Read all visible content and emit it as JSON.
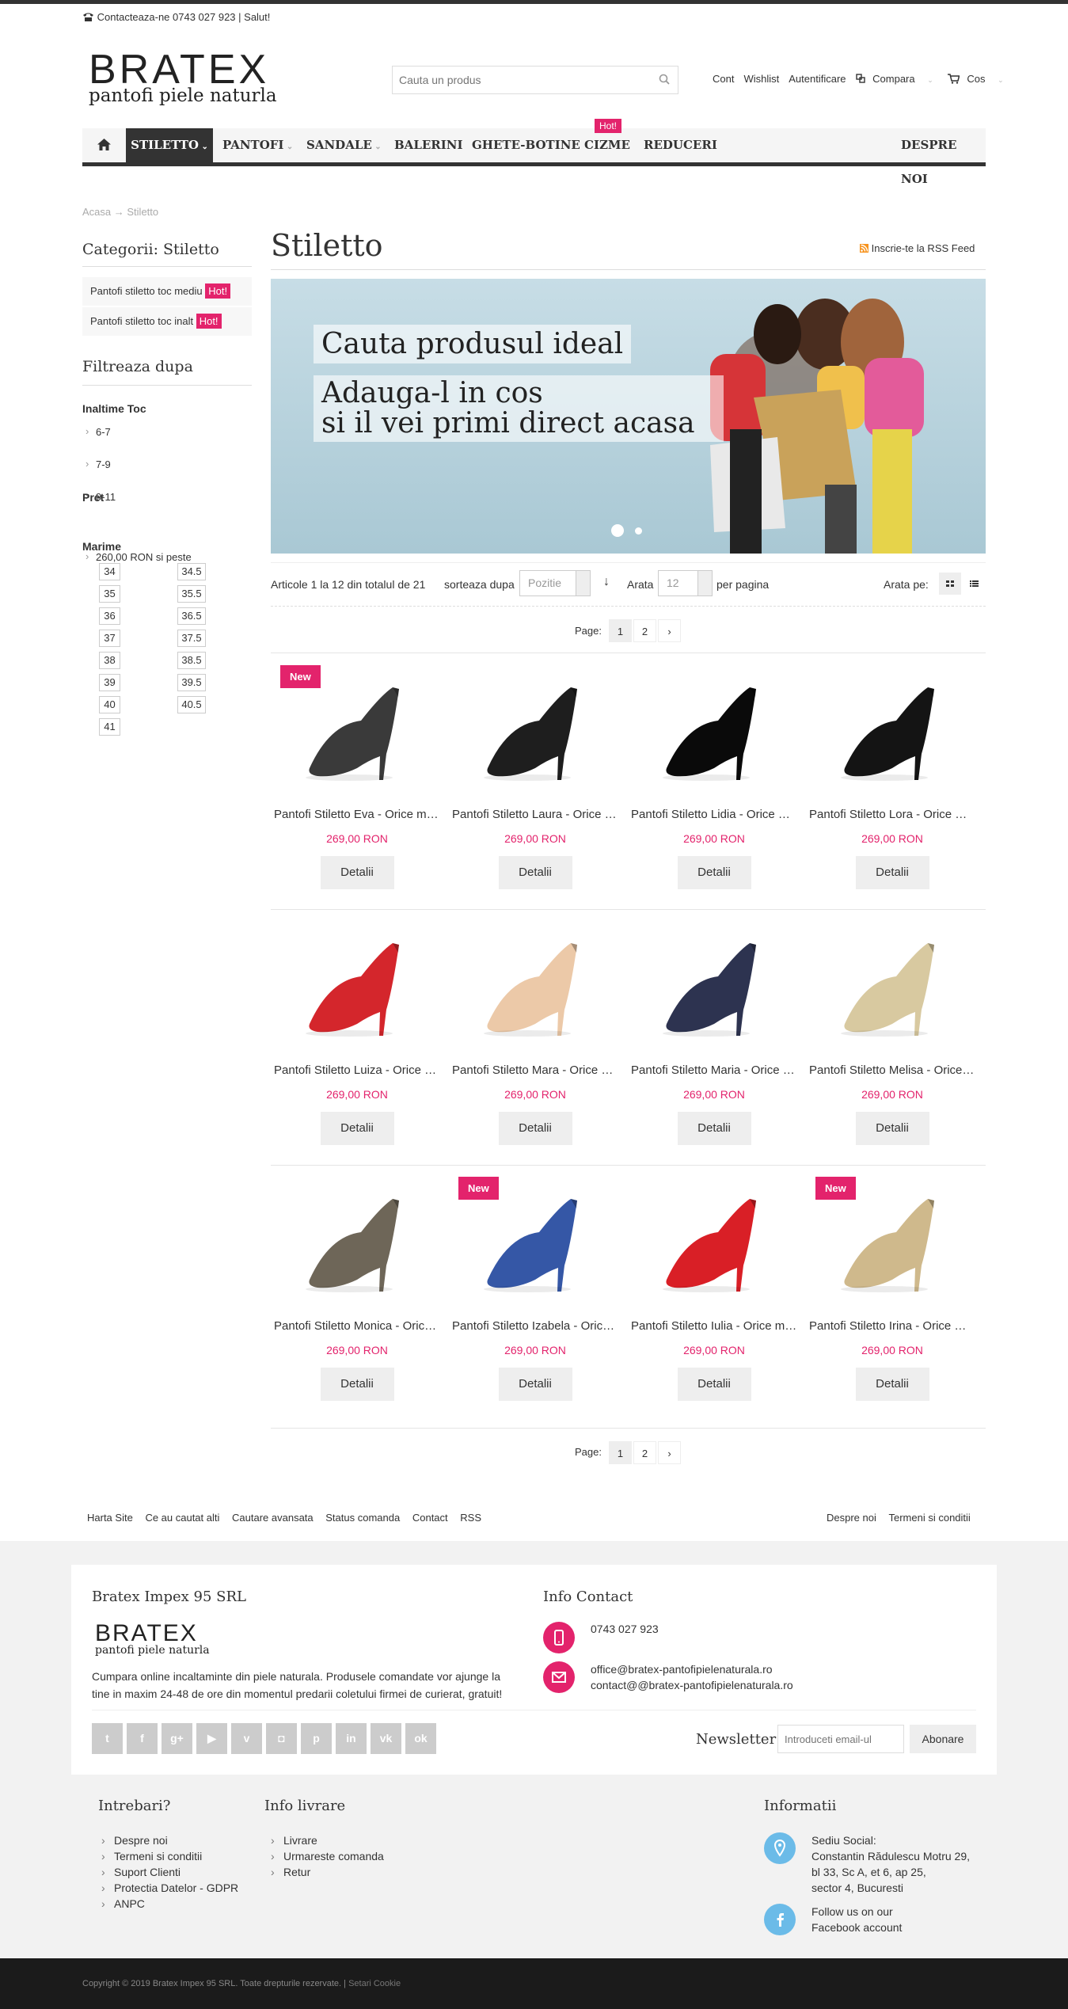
{
  "topbar": {
    "contact": "Contacteaza-ne 0743 027 923 | Salut!"
  },
  "logo": {
    "name": "BRATEX",
    "tagline": "pantofi piele naturla"
  },
  "search": {
    "placeholder": "Cauta un produs"
  },
  "header_links": {
    "account": "Cont",
    "wishlist": "Wishlist",
    "login": "Autentificare",
    "compare": "Compara",
    "cart": "Cos"
  },
  "nav": {
    "items": [
      "STILETTO",
      "PANTOFI",
      "SANDALE",
      "BALERINI",
      "GHETE-BOTINE",
      "CIZME",
      "REDUCERI",
      "DESPRE NOI"
    ],
    "hot_badge": "Hot!"
  },
  "breadcrumb": {
    "home": "Acasa",
    "current": "Stiletto"
  },
  "sidebar": {
    "categories_title": "Categorii: Stiletto",
    "categories": [
      {
        "label": "Pantofi stiletto toc mediu",
        "badge": "Hot!"
      },
      {
        "label": "Pantofi stiletto toc inalt",
        "badge": "Hot!"
      }
    ],
    "filter_title": "Filtreaza dupa",
    "heel_title": "Inaltime Toc",
    "heel_options": [
      "6-7",
      "7-9",
      "9-11"
    ],
    "price_title": "Pret",
    "price_options": [
      "260,00 RON si peste"
    ],
    "size_title": "Marime",
    "sizes_left": [
      "34",
      "35",
      "36",
      "37",
      "38",
      "39",
      "40",
      "41"
    ],
    "sizes_right": [
      "34.5",
      "35.5",
      "36.5",
      "37.5",
      "38.5",
      "39.5",
      "40.5"
    ]
  },
  "page": {
    "title": "Stiletto",
    "rss": "Inscrie-te la RSS Feed"
  },
  "banner": {
    "line1": "Cauta produsul ideal",
    "line2": "Adauga-l in cos",
    "line3": "si il vei primi direct acasa"
  },
  "toolbar": {
    "count": "Articole 1 la 12 din totalul de 21",
    "sort_label": "sorteaza dupa",
    "sort_value": "Pozitie",
    "show_label": "Arata",
    "show_value": "12",
    "per_page": "per pagina",
    "view_label": "Arata pe:"
  },
  "pager": {
    "label": "Page:",
    "pages": [
      "1",
      "2"
    ],
    "next": "›"
  },
  "products": [
    {
      "name": "Pantofi Stiletto Eva - Orice marime",
      "price": "269,00 RON",
      "button": "Detalii",
      "badge": "New",
      "color": "#3a3a3a"
    },
    {
      "name": "Pantofi Stiletto Laura - Orice marime",
      "price": "269,00 RON",
      "button": "Detalii",
      "badge": "",
      "color": "#1e1e1e"
    },
    {
      "name": "Pantofi Stiletto Lidia - Orice marime",
      "price": "269,00 RON",
      "button": "Detalii",
      "badge": "",
      "color": "#0a0a0a"
    },
    {
      "name": "Pantofi Stiletto Lora - Orice marime",
      "price": "269,00 RON",
      "button": "Detalii",
      "badge": "",
      "color": "#141414"
    },
    {
      "name": "Pantofi Stiletto Luiza - Orice marime",
      "price": "269,00 RON",
      "button": "Detalii",
      "badge": "",
      "color": "#d4262c"
    },
    {
      "name": "Pantofi Stiletto Mara - Orice marime",
      "price": "269,00 RON",
      "button": "Detalii",
      "badge": "",
      "color": "#ecc9a8"
    },
    {
      "name": "Pantofi Stiletto Maria - Orice marime",
      "price": "269,00 RON",
      "button": "Detalii",
      "badge": "",
      "color": "#2d3350"
    },
    {
      "name": "Pantofi Stiletto Melisa - Orice marime",
      "price": "269,00 RON",
      "button": "Detalii",
      "badge": "",
      "color": "#d8c9a0"
    },
    {
      "name": "Pantofi Stiletto Monica - Orice marime",
      "price": "269,00 RON",
      "button": "Detalii",
      "badge": "",
      "color": "#6e6658"
    },
    {
      "name": "Pantofi Stiletto Izabela - Orice marime",
      "price": "269,00 RON",
      "button": "Detalii",
      "badge": "New",
      "color": "#3557a6"
    },
    {
      "name": "Pantofi Stiletto Iulia - Orice marime",
      "price": "269,00 RON",
      "button": "Detalii",
      "badge": "",
      "color": "#d91f26"
    },
    {
      "name": "Pantofi Stiletto Irina - Orice marime",
      "price": "269,00 RON",
      "button": "Detalii",
      "badge": "New",
      "color": "#cfb98c"
    }
  ],
  "footer_links": {
    "left": [
      "Harta Site",
      "Ce au cautat alti",
      "Cautare avansata",
      "Status comanda",
      "Contact",
      "RSS"
    ],
    "right": [
      "Despre noi",
      "Termeni si conditii"
    ]
  },
  "company": {
    "title": "Bratex Impex 95 SRL",
    "desc1": "Cumpara online incaltaminte din piele naturala. Produsele comandate vor ajunge la",
    "desc2": "tine in maxim 24-48 de ore din momentul predarii coletului firmei de curierat, gratuit!"
  },
  "contact": {
    "title": "Info Contact",
    "phone": "0743 027 923",
    "email1": "office@bratex-pantofipielenaturala.ro",
    "email2": "contact@@bratex-pantofipielenaturala.ro"
  },
  "social": [
    "twitter-icon",
    "facebook-icon",
    "google-plus-icon",
    "youtube-icon",
    "vimeo-icon",
    "instagram-icon",
    "pinterest-icon",
    "linkedin-icon",
    "vk-icon",
    "odnoklassniki-icon"
  ],
  "newsletter": {
    "title": "Newsletter",
    "placeholder": "Introduceti email-ul",
    "button": "Abonare"
  },
  "footer_cols": {
    "questions": {
      "title": "Intrebari?",
      "items": [
        "Despre noi",
        "Termeni si conditii",
        "Suport Clienti",
        "Protectia Datelor - GDPR",
        "ANPC"
      ]
    },
    "delivery": {
      "title": "Info livrare",
      "items": [
        "Livrare",
        "Urmareste comanda",
        "Retur"
      ]
    },
    "info": {
      "title": "Informatii",
      "address_label": "Sediu Social:",
      "address1": "Constantin Rădulescu Motru 29,",
      "address2": "bl 33, Sc A, et 6, ap 25,",
      "address3": "sector 4, Bucuresti",
      "fb1": "Follow us on our",
      "fb2": "Facebook account"
    }
  },
  "copyright": {
    "text": "Copyright © 2019 Bratex Impex 95 SRL. Toate drepturile rezervate.",
    "cookie": "Setari Cookie"
  },
  "colors": {
    "accent": "#e3236c",
    "dark": "#333333",
    "info_blue": "#6bbbe8"
  }
}
